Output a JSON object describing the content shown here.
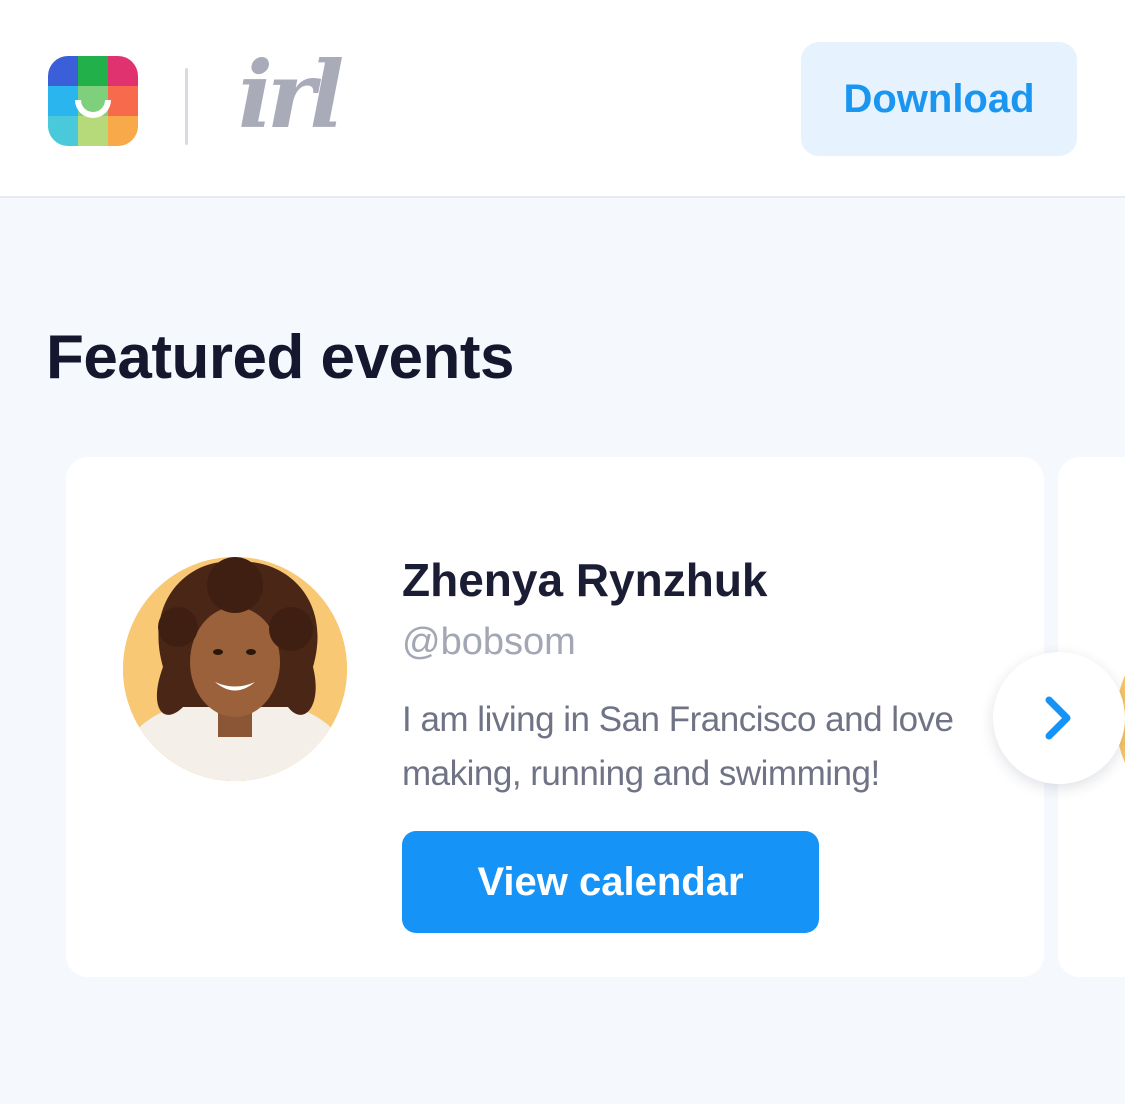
{
  "header": {
    "brand_wordmark": "irl",
    "download_label": "Download",
    "logo_colors": [
      "#3a5fd9",
      "#22b04b",
      "#e0326f",
      "#2bb5ee",
      "#7ed07d",
      "#f76a4c",
      "#49c9d9",
      "#b6d97a",
      "#f8aa4a"
    ]
  },
  "section": {
    "title": "Featured events"
  },
  "featured_event": {
    "name": "Zhenya Rynzhuk",
    "handle": "@bobsom",
    "bio": "I am living in San Francisco and love making, running and swimming!",
    "button_label": "View calendar"
  },
  "carousel": {
    "next_icon": "chevron-right-icon"
  },
  "colors": {
    "accent": "#1693f7",
    "title": "#15172f",
    "background": "#f5f8fd"
  }
}
